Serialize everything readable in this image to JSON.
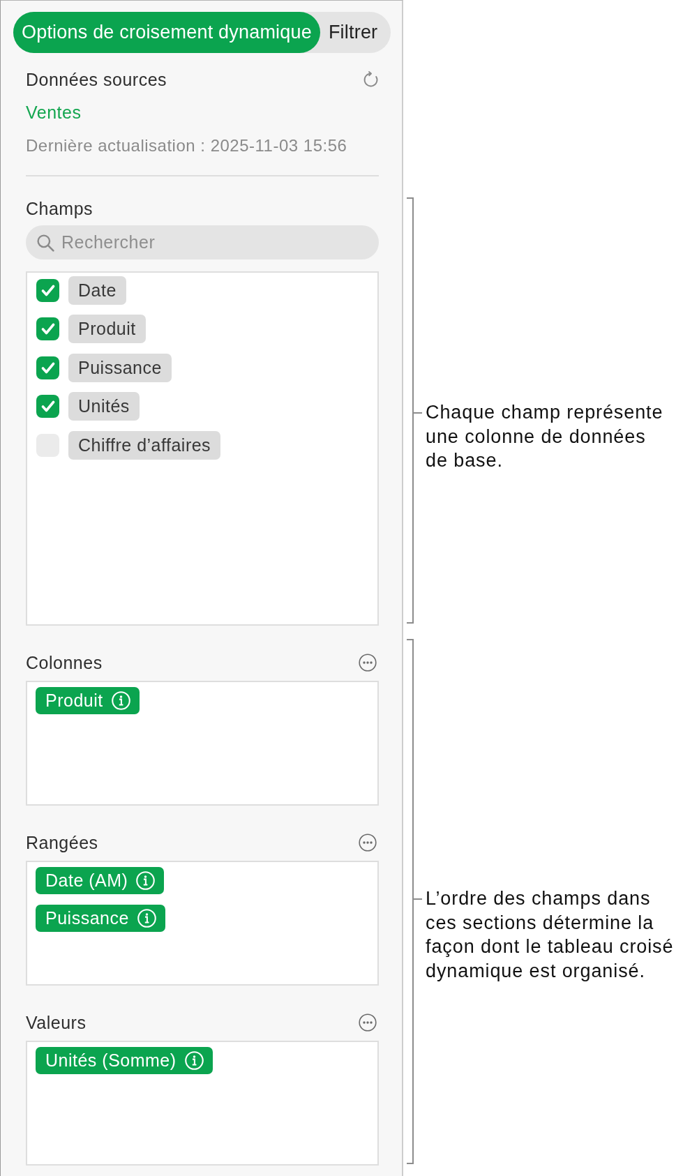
{
  "tabs": [
    {
      "label": "Options de croisement dynamique",
      "selected": true
    },
    {
      "label": "Filtrer",
      "selected": false
    }
  ],
  "source_data": {
    "title": "Données sources",
    "table": "Ventes",
    "last_refresh": "Dernière actualisation : 2025-11-03 15:56"
  },
  "fields": {
    "title": "Champs",
    "search": {
      "placeholder": "Rechercher"
    },
    "items": [
      {
        "label": "Date",
        "checked": true
      },
      {
        "label": "Produit",
        "checked": true
      },
      {
        "label": "Puissance",
        "checked": true
      },
      {
        "label": "Unités",
        "checked": true
      },
      {
        "label": "Chiffre d’affaires",
        "checked": false
      }
    ]
  },
  "sections": [
    {
      "title": "Colonnes",
      "chips": [
        "Produit"
      ]
    },
    {
      "title": "Rangées",
      "chips": [
        "Date (AM)",
        "Puissance"
      ]
    },
    {
      "title": "Valeurs",
      "chips": [
        "Unités (Somme)"
      ]
    }
  ],
  "callouts": [
    {
      "text": "Chaque champ représente une colonne de données de base."
    },
    {
      "text": "L’ordre des champs dans ces sections détermine la façon dont le tableau croisé dynamique est organisé."
    }
  ]
}
